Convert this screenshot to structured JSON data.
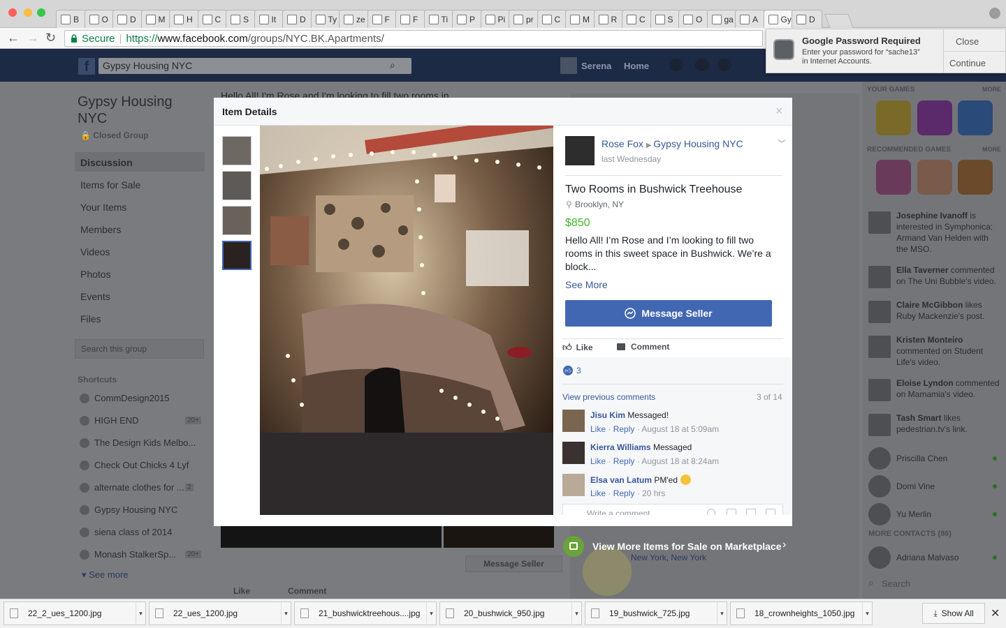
{
  "browser": {
    "tabs": [
      {
        "icon": "page-icon",
        "label": "B"
      },
      {
        "icon": "circle-icon",
        "label": "O"
      },
      {
        "icon": "zen-icon",
        "label": "D"
      },
      {
        "icon": "fc-icon",
        "label": "M"
      },
      {
        "icon": "f-icon",
        "label": "H"
      },
      {
        "icon": "person-icon",
        "label": "C"
      },
      {
        "icon": "gear-icon",
        "label": "S"
      },
      {
        "icon": "globe-icon",
        "label": "It"
      },
      {
        "icon": "de-icon",
        "label": "D"
      },
      {
        "icon": "t-icon",
        "label": "Ty"
      },
      {
        "icon": "dash-icon",
        "label": "ze"
      },
      {
        "icon": "fj-icon",
        "label": "F"
      },
      {
        "icon": "fj-icon",
        "label": "F"
      },
      {
        "icon": "x-icon",
        "label": "Ti"
      },
      {
        "icon": "page-icon",
        "label": "P"
      },
      {
        "icon": "pinterest-icon",
        "label": "Pi"
      },
      {
        "icon": "phone-icon",
        "label": "pr"
      },
      {
        "icon": "page-icon",
        "label": "C"
      },
      {
        "icon": "n-icon",
        "label": "M"
      },
      {
        "icon": "blank-icon",
        "label": "R"
      },
      {
        "icon": "f-icon",
        "label": "C"
      },
      {
        "icon": "c-icon",
        "label": "S"
      },
      {
        "icon": "dot-icon",
        "label": "O"
      },
      {
        "icon": "google-icon",
        "label": "ga"
      },
      {
        "icon": "a-icon",
        "label": "A"
      },
      {
        "icon": "blank-icon",
        "label": "Gy",
        "active": true
      },
      {
        "icon": "page-icon",
        "label": "D"
      }
    ],
    "secure_label": "Secure",
    "url_scheme": "https://",
    "url_host": "www.facebook.com",
    "url_path": "/groups/NYC.BK.Apartments/"
  },
  "toast": {
    "title": "Google Password Required",
    "body_line1": "Enter your password for “sache13”",
    "body_line2": "in Internet Accounts.",
    "close": "Close",
    "continue": "Continue"
  },
  "fb": {
    "search_value": "Gypsy Housing NYC",
    "user_name": "Serena",
    "home_label": "Home",
    "group_name_line1": "Gypsy Housing",
    "group_name_line2": "NYC",
    "group_type": "Closed Group",
    "nav": [
      "Discussion",
      "Items for Sale",
      "Your Items",
      "Members",
      "Videos",
      "Photos",
      "Events",
      "Files"
    ],
    "search_group_placeholder": "Search this group",
    "shortcuts_header": "Shortcuts",
    "shortcuts": [
      {
        "label": "CommDesign2015",
        "badge": ""
      },
      {
        "label": "HIGH END",
        "badge": "20+"
      },
      {
        "label": "The Design Kids Melbo...",
        "badge": ""
      },
      {
        "label": "Check Out Chicks 4 Lyf",
        "badge": ""
      },
      {
        "label": "alternate clothes for ...",
        "badge": "2"
      },
      {
        "label": "Gypsy Housing NYC",
        "badge": ""
      },
      {
        "label": "siena class of 2014",
        "badge": ""
      },
      {
        "label": "Monash StalkerSp...",
        "badge": "20+"
      }
    ],
    "see_more": "See more",
    "post_text_peek": "Hello All! I'm Rose and I'm looking to fill two rooms in",
    "bg_message_seller": "Message Seller",
    "bg_like": "Like",
    "bg_comment": "Comment",
    "location_peek": "New York, New York",
    "marketplace_banner": "View More Items for Sale on Marketplace",
    "right": {
      "your_games": "YOUR GAMES",
      "more": "MORE",
      "recommended_games": "RECOMMENDED GAMES",
      "ticker": [
        {
          "name": "Josephine Ivanoff",
          "rest": " is interested in Symphonica: Armand Van Helden with the MSO."
        },
        {
          "name": "Ella Taverner",
          "rest": " commented on The Uni Bubble's video."
        },
        {
          "name": "Claire McGibbon",
          "rest": " likes Ruby Mackenzie's post."
        },
        {
          "name": "Kristen Monteiro",
          "rest": " commented on Student Life's video."
        },
        {
          "name": "Eloise Lyndon",
          "rest": " commented on Mamamia's video."
        },
        {
          "name": "Tash Smart",
          "rest": " likes pedestrian.tv's link."
        }
      ],
      "contacts": [
        "Priscilla Chen",
        "Domi Vine",
        "Yu Merlin"
      ],
      "more_contacts": "MORE CONTACTS (86)",
      "more_contacts_list": [
        "Adriana Malvaso"
      ],
      "chat_search": "Search"
    }
  },
  "modal": {
    "title": "Item Details",
    "close_glyph": "×",
    "seller": "Rose Fox",
    "group": "Gypsy Housing NYC",
    "time": "last Wednesday",
    "item_title": "Two Rooms in Bushwick Treehouse",
    "location": "Brooklyn, NY",
    "price": "$850",
    "description": "Hello All! I’m Rose and I’m looking to fill two rooms in this sweet space in Bushwick. We’re a block...",
    "see_more": "See More",
    "message_seller": "Message Seller",
    "like": "Like",
    "comment": "Comment",
    "reactions_count": "3",
    "view_previous": "View previous comments",
    "comment_count": "3 of 14",
    "comments": [
      {
        "name": "Jisu Kim",
        "text": " Messaged!",
        "like": "Like",
        "reply": "Reply",
        "time": "August 18 at 5:09am"
      },
      {
        "name": "Kierra Williams",
        "text": " Messaged",
        "like": "Like",
        "reply": "Reply",
        "time": "August 18 at 8:24am"
      },
      {
        "name": "Elsa van Latum",
        "text": " PM'ed",
        "like": "Like",
        "reply": "Reply",
        "time": "20 hrs"
      }
    ],
    "write_comment_placeholder": "Write a comment..."
  },
  "downloads": {
    "items": [
      "22_2_ues_1200.jpg",
      "22_ues_1200.jpg",
      "21_bushwicktreehous....jpg",
      "20_bushwick_950.jpg",
      "19_bushwick_725.jpg",
      "18_crownheights_1050.jpg"
    ],
    "show_all": "Show All"
  },
  "colors": {
    "fb_blue": "#4267b2",
    "link": "#365899",
    "price_green": "#42b72a",
    "chrome_green": "#0b8043"
  }
}
